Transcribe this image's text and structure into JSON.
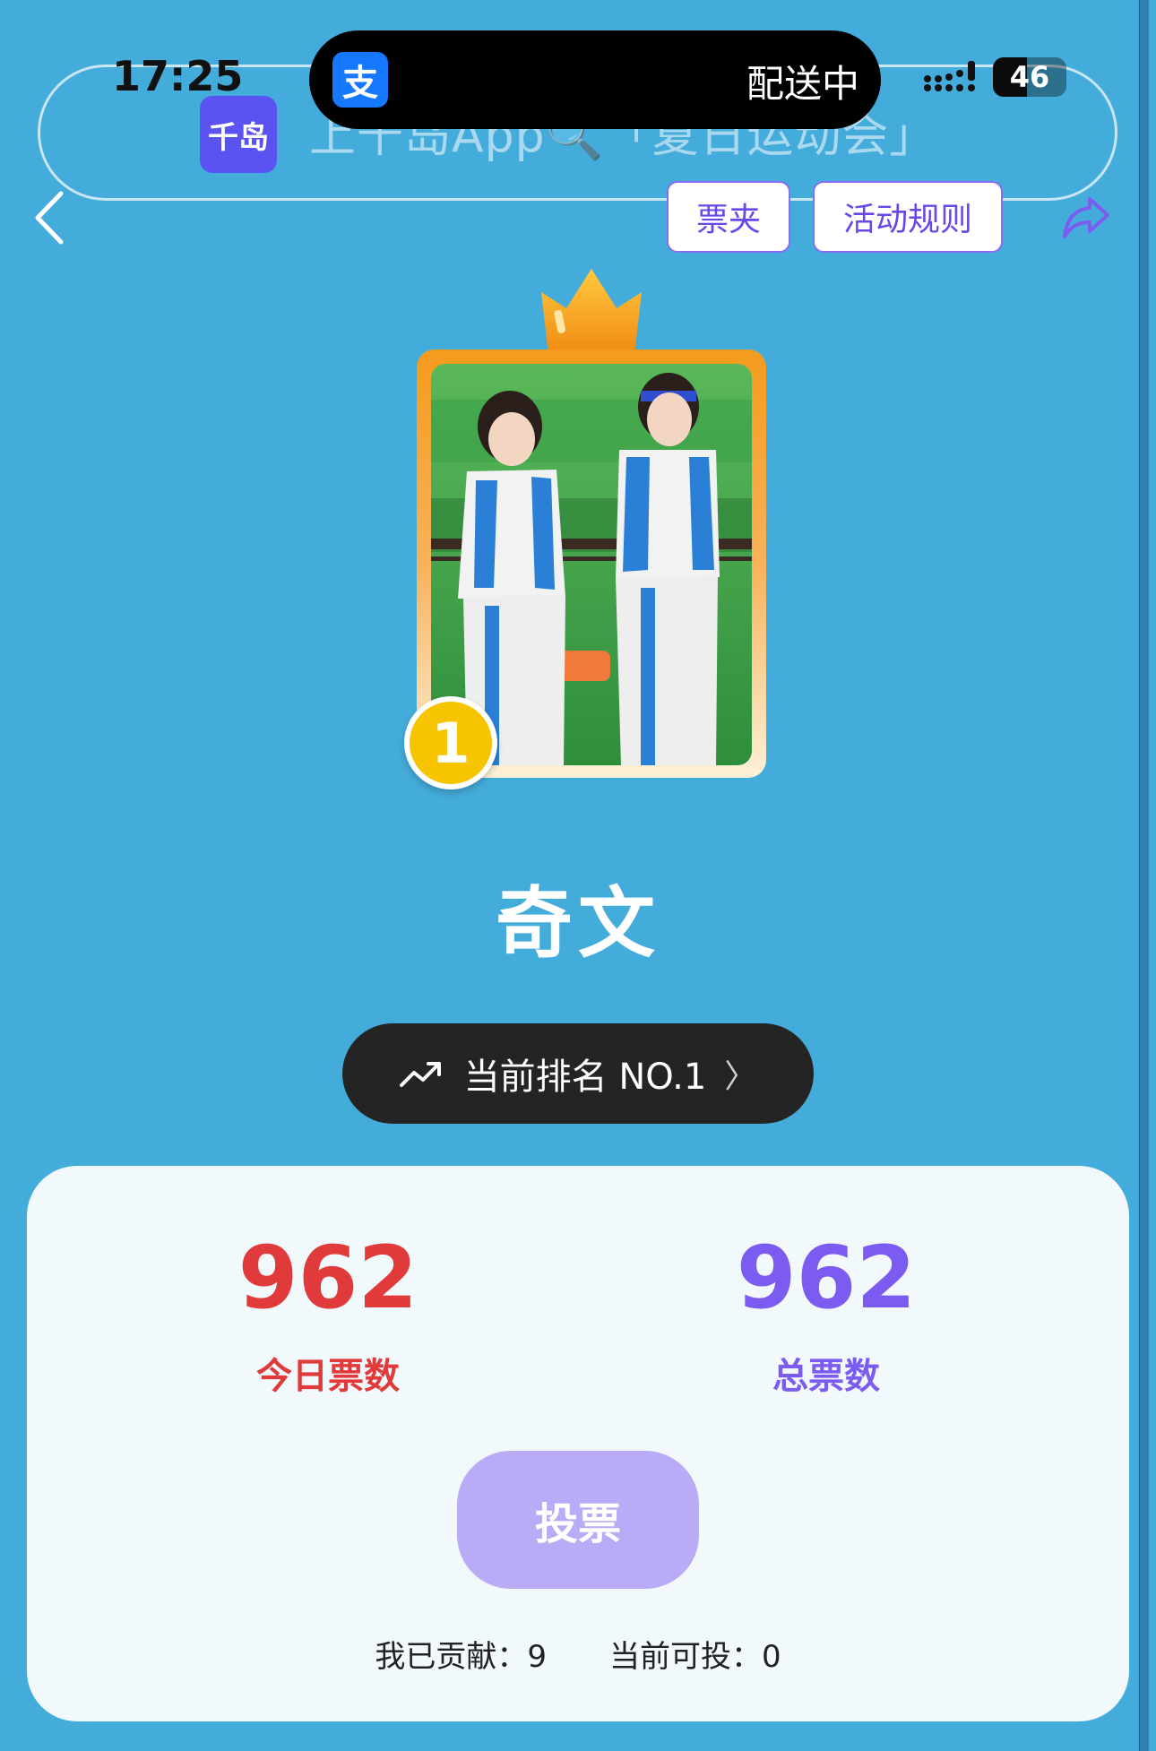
{
  "status_bar": {
    "time": "17:25",
    "island_app_icon": "alipay-icon",
    "island_app_glyph": "支",
    "island_text": "配送中",
    "battery": "46"
  },
  "banner": {
    "logo_text": "千岛",
    "text": "上千岛App🔍「夏日运动会」"
  },
  "nav": {
    "tickets_label": "票夹",
    "rules_label": "活动规则"
  },
  "idol": {
    "rank_badge": "1",
    "name": "奇文"
  },
  "rank_pill": {
    "label": "当前排名 NO.1",
    "chevron": "〉"
  },
  "stats": {
    "today_value": "962",
    "today_label": "今日票数",
    "total_value": "962",
    "total_label": "总票数"
  },
  "vote_button_label": "投票",
  "footer": {
    "contributed_label": "我已贡献：",
    "contributed_value": "9",
    "available_label": "当前可投：",
    "available_value": "0"
  },
  "colors": {
    "background": "#44acdb",
    "accent_purple": "#7c5cf0",
    "accent_red": "#e03a3a",
    "vote_button": "#b9abf5",
    "badge_gold": "#f6c400"
  }
}
